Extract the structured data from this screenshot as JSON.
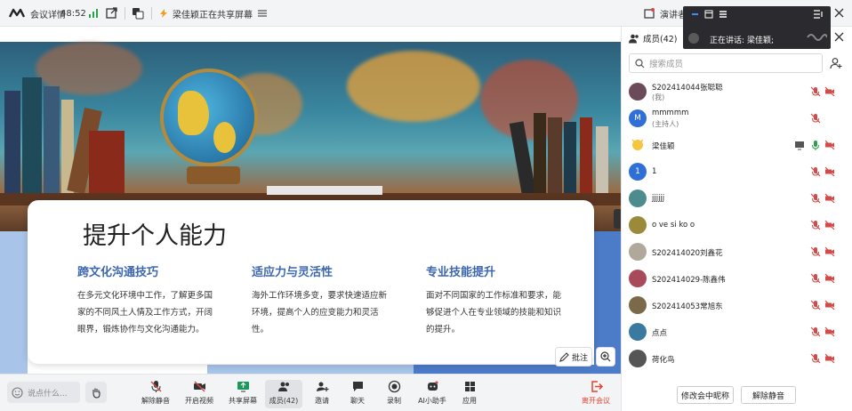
{
  "topbar": {
    "meeting_details": "会议详情",
    "timer": "48:52",
    "sharing_notice": "梁佳颖正在共享屏幕",
    "presenter_label": "演讲者"
  },
  "slide": {
    "title": "提升个人能力",
    "columns": [
      {
        "heading": "跨文化沟通技巧",
        "body": "在多元文化环境中工作，了解更多国家的不同风土人情及工作方式，开阔眼界，锻炼协作与文化沟通能力。"
      },
      {
        "heading": "适应力与灵活性",
        "body": "海外工作环境多变，要求快速适应新环境，提高个人的应变能力和灵活性。"
      },
      {
        "heading": "专业技能提升",
        "body": "面对不同国家的工作标准和要求，能够促进个人在专业领域的技能和知识的提升。"
      }
    ],
    "annotate_label": "批注"
  },
  "bottombar": {
    "chat_placeholder": "说点什么...",
    "tools": [
      "解除静音",
      "开启视频",
      "共享屏幕",
      "成员(42)",
      "邀请",
      "聊天",
      "录制",
      "AI小助手",
      "应用",
      "离开会议"
    ]
  },
  "panel": {
    "members_tab": "成员(42)",
    "search_placeholder": "搜索成员",
    "members": [
      {
        "name": "S202414044张聪聪",
        "sub": "(我)",
        "avatar": "photo",
        "color": "#6b4a5a"
      },
      {
        "name": "mmmmm",
        "sub": "(主持人)",
        "avatar": "M",
        "color": "#2f6fd6"
      },
      {
        "name": "梁佳颖",
        "sub": "",
        "avatar": "emoji",
        "color": "#f5c542"
      },
      {
        "name": "1",
        "sub": "",
        "avatar": "1",
        "color": "#2f6fd6"
      },
      {
        "name": "jjjjjj",
        "sub": "",
        "avatar": "photo",
        "color": "#4c8c8f"
      },
      {
        "name": "o ve si ko o",
        "sub": "",
        "avatar": "photo",
        "color": "#9a8a3a"
      },
      {
        "name": "S202414020刘鑫花",
        "sub": "",
        "avatar": "photo",
        "color": "#b0a89a"
      },
      {
        "name": "S202414029-陈鑫伟",
        "sub": "",
        "avatar": "photo",
        "color": "#a84a5a"
      },
      {
        "name": "S202414053常旭东",
        "sub": "",
        "avatar": "photo",
        "color": "#7a6a4a"
      },
      {
        "name": "点点",
        "sub": "",
        "avatar": "photo",
        "color": "#3a7aa0"
      },
      {
        "name": "荷化鸟",
        "sub": "",
        "avatar": "photo",
        "color": "#555555"
      }
    ],
    "rename_button": "修改会中昵称",
    "unmute_all_button": "解除静音"
  },
  "float": {
    "speaking_label": "正在讲话:",
    "speaker_name": "梁佳颖;"
  },
  "colors": {
    "accent_blue": "#3b67b0",
    "muted_red": "#d24a4a",
    "leave_red": "#e8432f",
    "timer_green": "#2aa24a"
  }
}
